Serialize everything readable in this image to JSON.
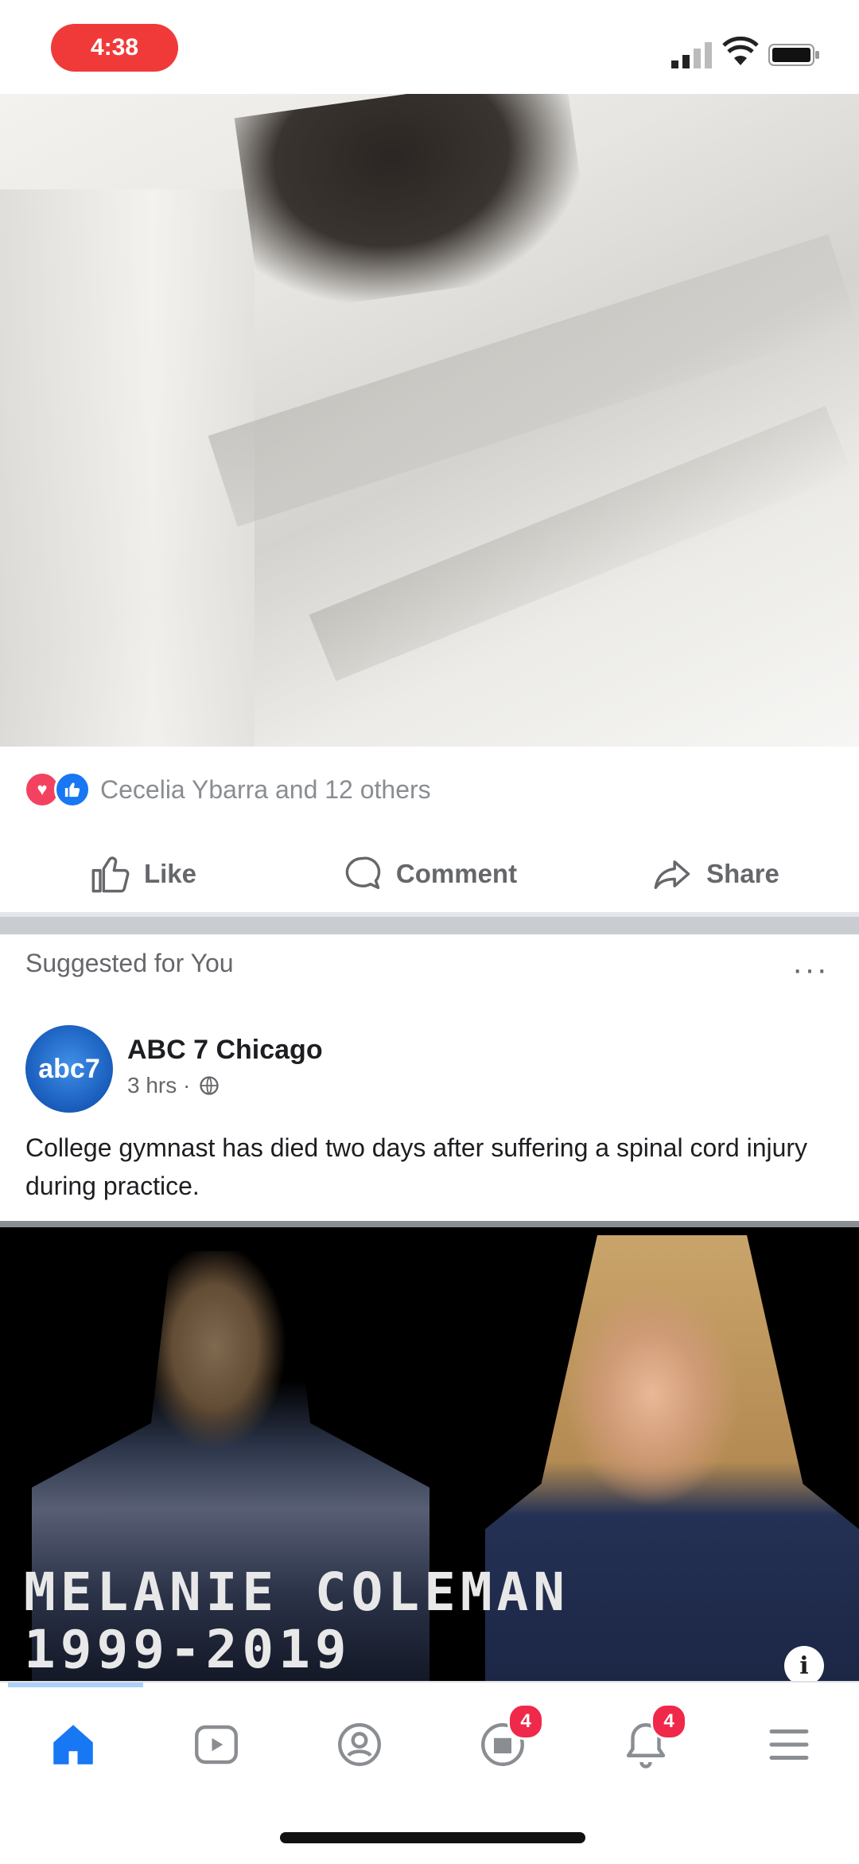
{
  "status_bar": {
    "time": "4:38"
  },
  "post": {
    "reactions_text": "Cecelia Ybarra and 12 others",
    "actions": {
      "like": "Like",
      "comment": "Comment",
      "share": "Share"
    }
  },
  "suggested": {
    "header": "Suggested for You",
    "more": "···",
    "page_name": "ABC 7 Chicago",
    "avatar_text": "abc7",
    "meta_time": "3 hrs ·",
    "text": "College gymnast has died two days after suffering a spinal cord injury during practice.",
    "image_name": "MELANIE COLEMAN",
    "image_years": "1999-2019",
    "info": "i"
  },
  "tabbar": {
    "watch_badge": "",
    "marketplace_badge": "4",
    "notifications_badge": "4",
    "active_color": "#1877f2",
    "inactive_color": "#8a8d91"
  }
}
